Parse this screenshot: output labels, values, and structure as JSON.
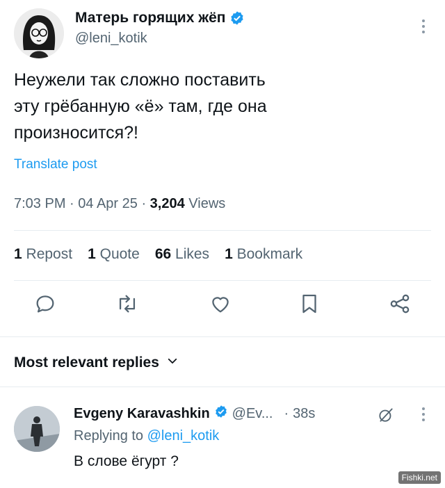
{
  "post": {
    "author_name": "Матерь горящих жёп",
    "handle": "@leni_kotik",
    "text_lines": [
      "Неужели так сложно поставить",
      "эту грёбанную «ё» там, где она",
      "произносится?!"
    ],
    "translate_label": "Translate post",
    "time": "7:03 PM",
    "date": "04 Apr 25",
    "views_count": "3,204",
    "views_label": "Views",
    "accent_color": "#1d9bf0"
  },
  "stats": {
    "reposts_count": "1",
    "reposts_label": "Repost",
    "quotes_count": "1",
    "quotes_label": "Quote",
    "likes_count": "66",
    "likes_label": "Likes",
    "bookmarks_count": "1",
    "bookmarks_label": "Bookmark"
  },
  "actions": [
    "reply-icon",
    "repost-icon",
    "like-icon",
    "bookmark-icon",
    "share-icon"
  ],
  "replies": {
    "header": "Most relevant replies"
  },
  "reply": {
    "name": "Evgeny Karavashkin",
    "handle": "@Ev...",
    "time": "38s",
    "replying_to_prefix": "Replying to",
    "replying_to_handle": "@leni_kotik",
    "text": "В слове ёгурт ?"
  },
  "watermark": "Fishki.net"
}
